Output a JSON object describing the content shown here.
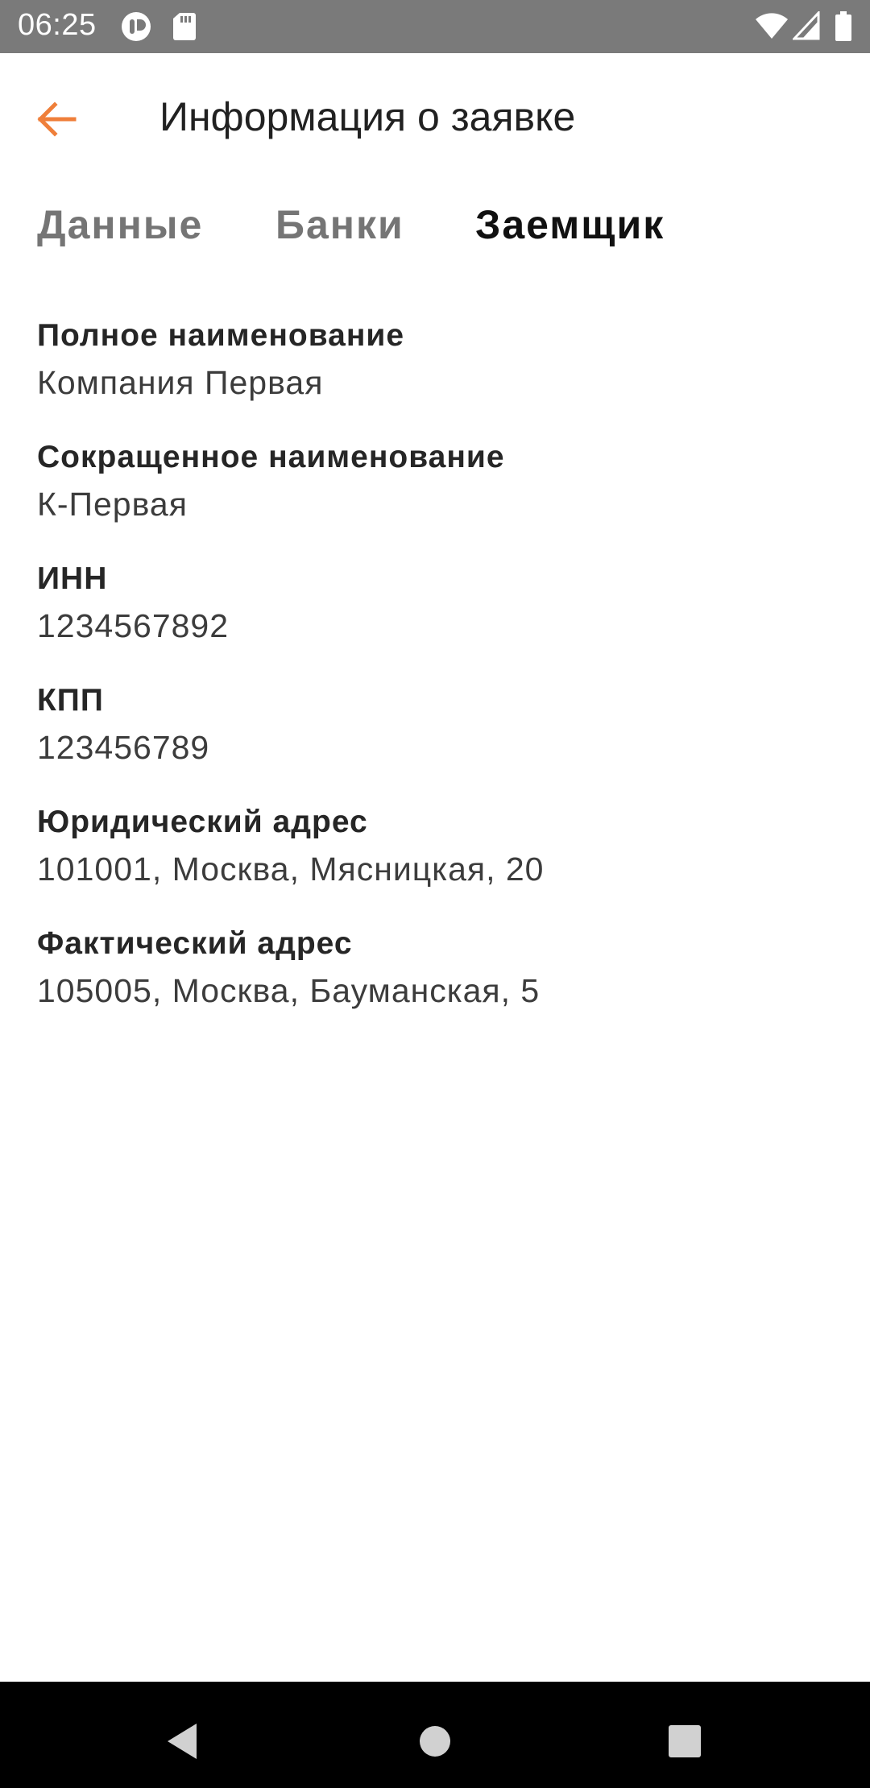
{
  "status_bar": {
    "time": "06:25",
    "icons": [
      "notification-icon",
      "sd-card-icon",
      "wifi-icon",
      "signal-icon",
      "battery-icon"
    ]
  },
  "app_bar": {
    "title": "Информация о заявке",
    "back_icon": "arrow-back-icon"
  },
  "tabs": [
    {
      "label": "Данные",
      "active": false
    },
    {
      "label": "Банки",
      "active": false
    },
    {
      "label": "Заемщик",
      "active": true
    }
  ],
  "borrower": {
    "items": [
      {
        "label": "Полное наименование",
        "value": "Компания Первая"
      },
      {
        "label": "Сокращенное наименование",
        "value": "К-Первая"
      },
      {
        "label": "ИНН",
        "value": "1234567892"
      },
      {
        "label": "КПП",
        "value": "123456789"
      },
      {
        "label": "Юридический адрес",
        "value": "101001, Москва, Мясницкая, 20"
      },
      {
        "label": "Фактический адрес",
        "value": "105005, Москва, Бауманская, 5"
      }
    ]
  },
  "colors": {
    "accent": "#ef7f3a",
    "status_bar": "#7a7a7a",
    "nav_bar": "#000000",
    "tab_inactive": "#757575",
    "tab_active": "#111111"
  },
  "nav_bar": {
    "icons": [
      "nav-back-icon",
      "nav-home-icon",
      "nav-recents-icon"
    ]
  }
}
